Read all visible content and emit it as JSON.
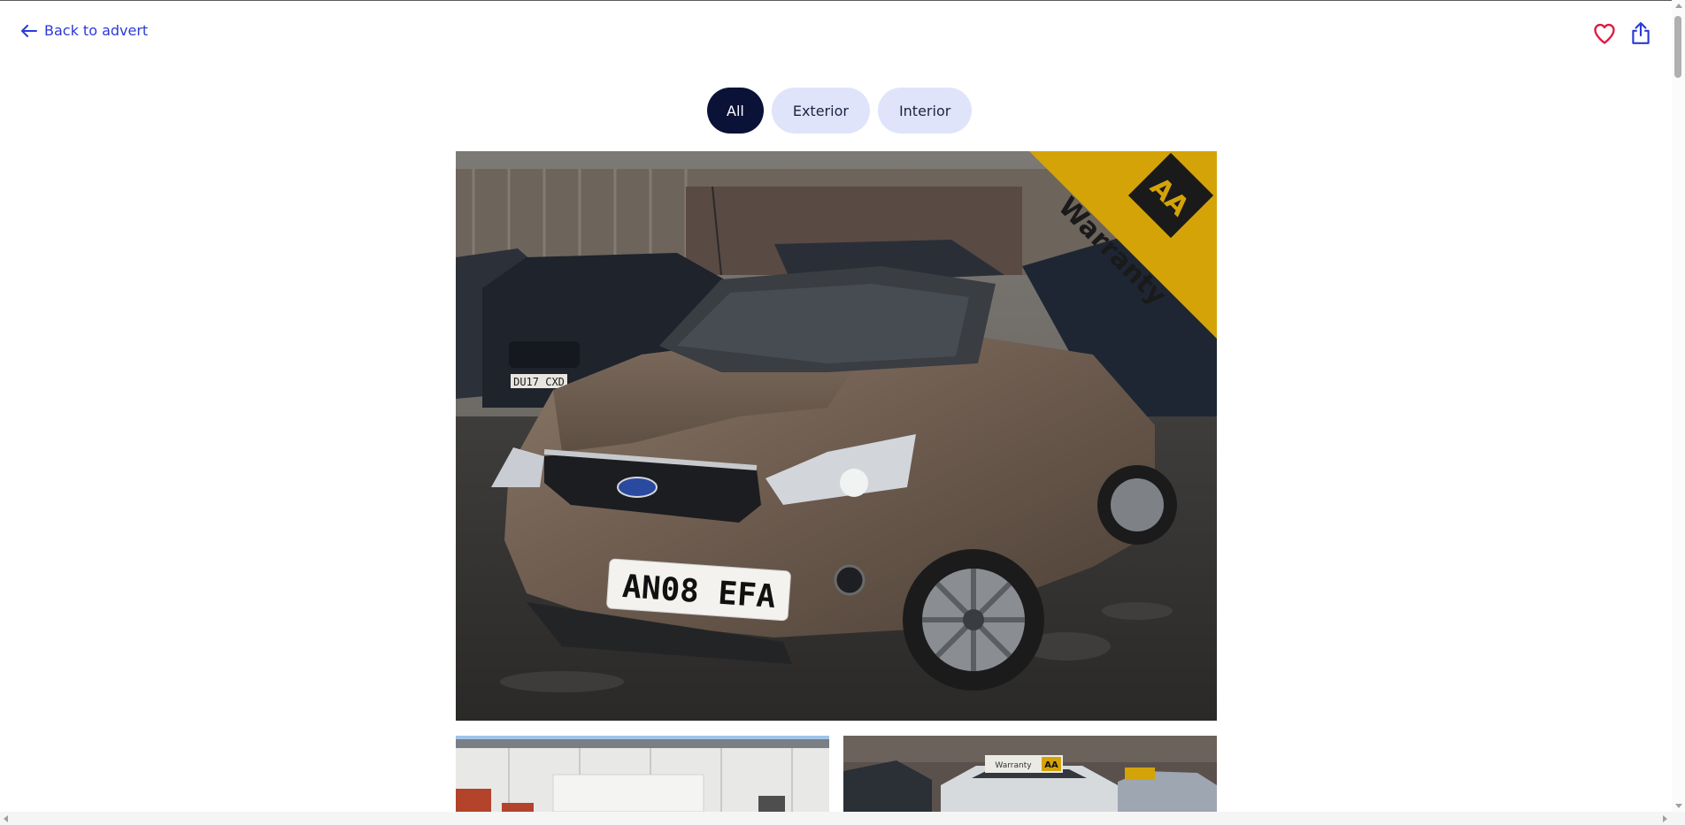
{
  "nav": {
    "back_label": "Back to advert",
    "back_icon": "arrow-left-icon",
    "favourite_icon": "heart-icon",
    "share_icon": "share-icon"
  },
  "filters": {
    "tabs": [
      {
        "label": "All",
        "selected": true
      },
      {
        "label": "Exterior",
        "selected": false
      },
      {
        "label": "Interior",
        "selected": false
      }
    ]
  },
  "gallery": {
    "main_photo": {
      "plate": "AN08 EFA",
      "background_plate": "DU17 CXD",
      "badge_logo": "AA",
      "badge_text": "Warranty"
    },
    "thumb_2": {
      "sign_text": "Warranty",
      "sign_logo": "AA"
    }
  },
  "colors": {
    "link": "#2a3ad8",
    "tab_active_bg": "#0b1238",
    "tab_bg": "#dfe4fb",
    "heart": "#e0193f",
    "share": "#2a3ad8",
    "aa_yellow": "#d4a308"
  }
}
